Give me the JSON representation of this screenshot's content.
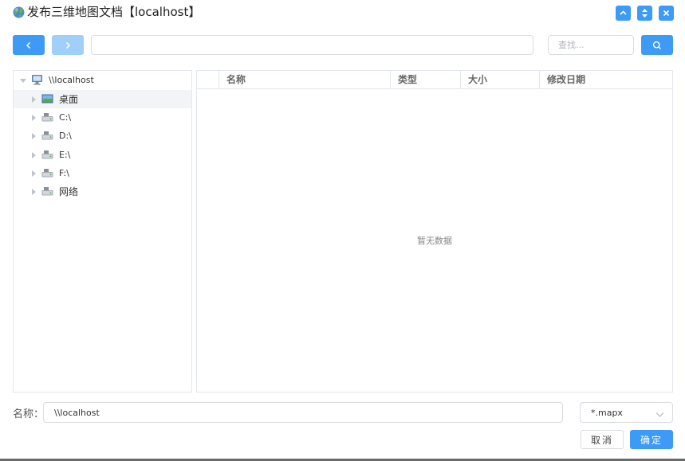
{
  "window": {
    "title": "发布三维地图文档【localhost】",
    "icons": [
      "globe-icon",
      "minimize-icon",
      "maximize-icon",
      "close-icon"
    ]
  },
  "toolbar": {
    "path_value": "",
    "search_placeholder": "查找...",
    "icons": [
      "chevron-left-icon",
      "chevron-right-icon",
      "search-icon"
    ]
  },
  "tree": {
    "root": {
      "label": "\\\\localhost",
      "icon": "computer-icon",
      "expanded": true
    },
    "items": [
      {
        "label": "桌面",
        "icon": "desktop-icon",
        "selected": true
      },
      {
        "label": "C:\\",
        "icon": "drive-icon"
      },
      {
        "label": "D:\\",
        "icon": "drive-icon"
      },
      {
        "label": "E:\\",
        "icon": "drive-icon"
      },
      {
        "label": "F:\\",
        "icon": "drive-icon"
      },
      {
        "label": "网络",
        "icon": "network-icon"
      }
    ]
  },
  "file_list": {
    "columns": [
      "名称",
      "类型",
      "大小",
      "修改日期"
    ],
    "empty_text": "暂无数据"
  },
  "footer": {
    "name_label": "名称：",
    "name_value": "\\\\localhost",
    "filter_value": "*.mapx",
    "cancel_label": "取消",
    "ok_label": "确定"
  },
  "colors": {
    "accent": "#3d9bf5",
    "accent_disabled": "#a0cffa",
    "border": "#e4e7ed",
    "selected_row": "#f2f4f7"
  }
}
